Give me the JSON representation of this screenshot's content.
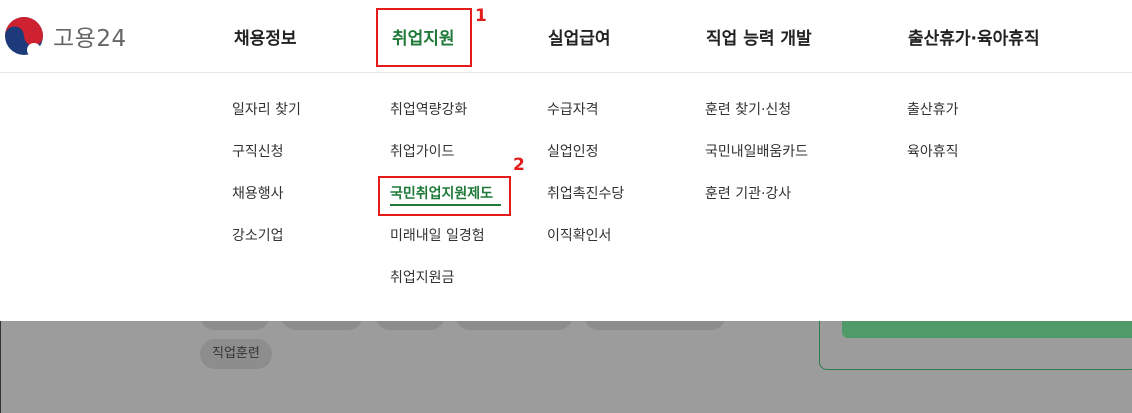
{
  "brand": {
    "name": "고용24",
    "logo_icon": "korea-government-emblem-icon"
  },
  "nav": {
    "items": [
      {
        "label": "채용정보"
      },
      {
        "label": "취업지원",
        "active": true
      },
      {
        "label": "실업급여"
      },
      {
        "label": "직업 능력 개발"
      },
      {
        "label": "출산휴가·육아휴직"
      }
    ]
  },
  "columns": {
    "recruit": [
      "일자리 찾기",
      "구직신청",
      "채용행사",
      "강소기업"
    ],
    "jobsupport": [
      "취업역량강화",
      "취업가이드",
      "국민취업지원제도",
      "미래내일 일경험",
      "취업지원금"
    ],
    "unemployment": [
      "수급자격",
      "실업인정",
      "취업촉진수당",
      "이직확인서"
    ],
    "training": [
      "훈련 찾기·신청",
      "국민내일배움카드",
      "훈련 기관·강사"
    ],
    "leave": [
      "출산휴가",
      "육아휴직"
    ]
  },
  "annotations": {
    "step1": "1",
    "step2": "2"
  },
  "background": {
    "chip_label": "직업훈련"
  },
  "colors": {
    "active_green": "#1f7a3a",
    "annotation_red": "#e31b1b"
  }
}
